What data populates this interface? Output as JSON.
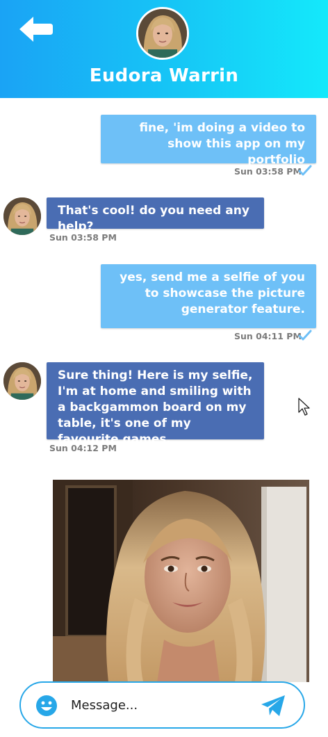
{
  "header": {
    "contact_name": "Eudora Warrin",
    "back_icon": "arrow-left-icon",
    "background_gradient": [
      "#1aa3f5",
      "#14e9fb"
    ]
  },
  "messages": [
    {
      "type": "sent",
      "text": "fine, 'im doing a video to show this app on my portfolio",
      "time": "Sun 03:58 PM",
      "read": true
    },
    {
      "type": "received",
      "text": "That's cool! do you need any help?",
      "time": "Sun 03:58 PM"
    },
    {
      "type": "sent",
      "text": "yes, send me a selfie of you to showcase the picture generator feature.",
      "time": "Sun 04:11 PM",
      "read": true
    },
    {
      "type": "received",
      "text": "Sure thing! Here is my selfie, I'm at home and smiling with a backgammon board on my table, it's one of my favourite games.",
      "time": "Sun 04:12 PM"
    },
    {
      "type": "received-image"
    }
  ],
  "composer": {
    "placeholder": "Message...",
    "emoji_icon": "emoji-icon",
    "send_icon": "send-icon"
  },
  "colors": {
    "sent_bubble": "#6ec0f7",
    "received_bubble": "#4a6db3",
    "accent": "#27a7e8",
    "timestamp": "#7b7b7b"
  }
}
